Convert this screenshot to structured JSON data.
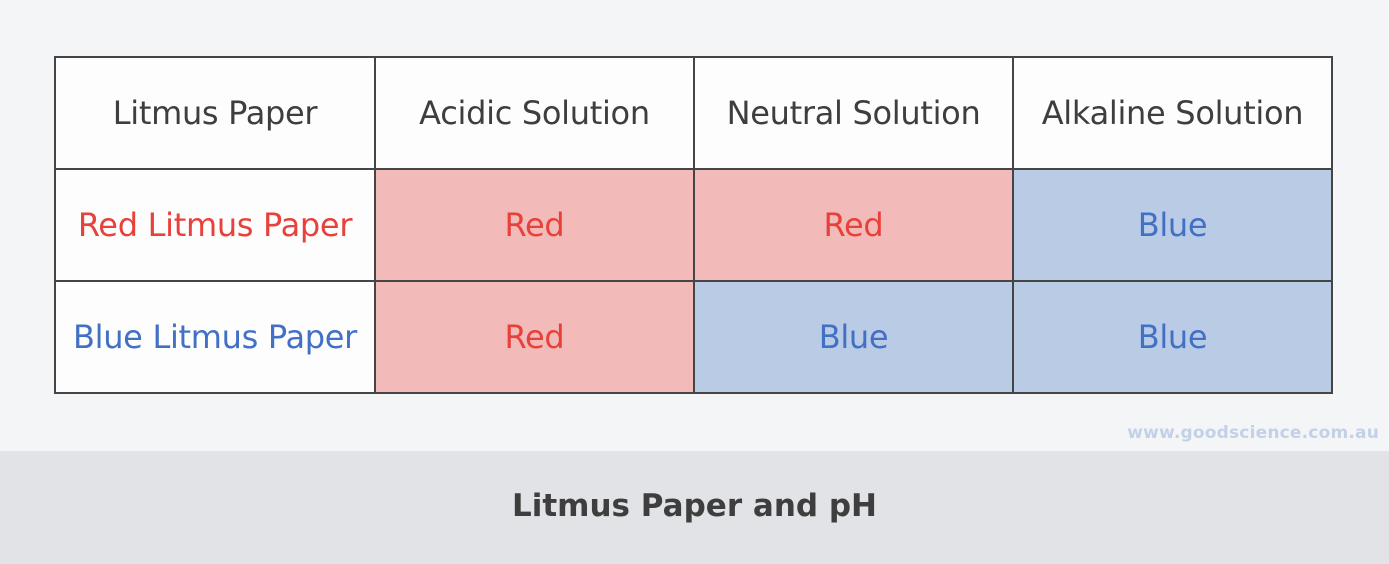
{
  "table": {
    "headers": [
      "Litmus Paper",
      "Acidic Solution",
      "Neutral Solution",
      "Alkaline Solution"
    ],
    "rows": [
      {
        "label": "Red Litmus Paper",
        "label_color": "red",
        "cells": [
          {
            "value": "Red",
            "color": "red"
          },
          {
            "value": "Red",
            "color": "red"
          },
          {
            "value": "Blue",
            "color": "blue"
          }
        ]
      },
      {
        "label": "Blue Litmus Paper",
        "label_color": "blue",
        "cells": [
          {
            "value": "Red",
            "color": "red"
          },
          {
            "value": "Blue",
            "color": "blue"
          },
          {
            "value": "Blue",
            "color": "blue"
          }
        ]
      }
    ]
  },
  "colors": {
    "red_text": "#e8403a",
    "blue_text": "#4170c4",
    "red_fill": "#f2bab8",
    "blue_fill": "#bacbe6",
    "border": "#454545",
    "footer_bg": "#e1e3e6",
    "page_bg": "#f4f5f7"
  },
  "watermark": "www.goodscience.com.au",
  "footer": {
    "title": "Litmus Paper and pH"
  }
}
